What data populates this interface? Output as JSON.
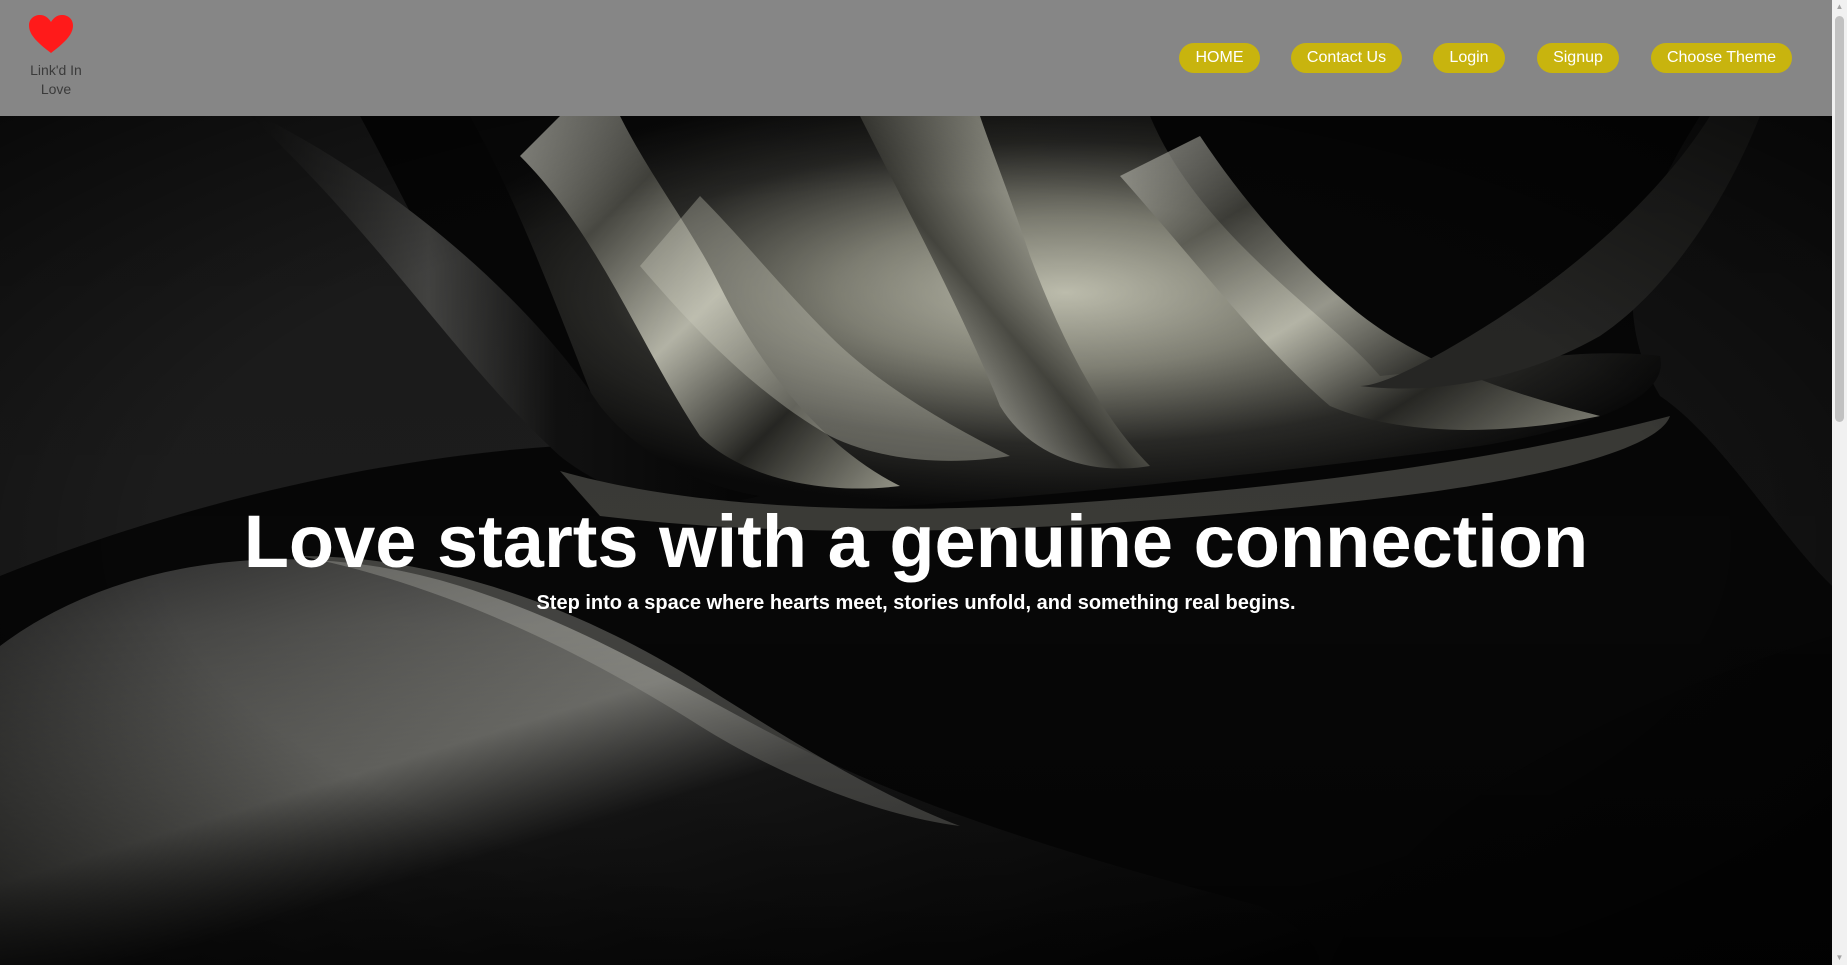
{
  "brand": {
    "icon": "heart-icon",
    "name": "Link'd In Love",
    "heart_color": "#ff1a1a"
  },
  "nav": {
    "items": [
      {
        "label": "HOME"
      },
      {
        "label": "Contact Us"
      },
      {
        "label": "Login"
      },
      {
        "label": "Signup"
      },
      {
        "label": "Choose Theme"
      }
    ],
    "button_color": "#c8b40e"
  },
  "hero": {
    "title": "Love starts with a genuine connection",
    "subtitle": "Step into a space where hearts meet, stories unfold, and something real begins."
  },
  "theme": {
    "header_bg": "#868686",
    "accent": "#c8b40e",
    "text": "#ffffff"
  },
  "scrollbar": {
    "up_icon": "chevron-up-icon",
    "down_icon": "chevron-down-icon"
  }
}
